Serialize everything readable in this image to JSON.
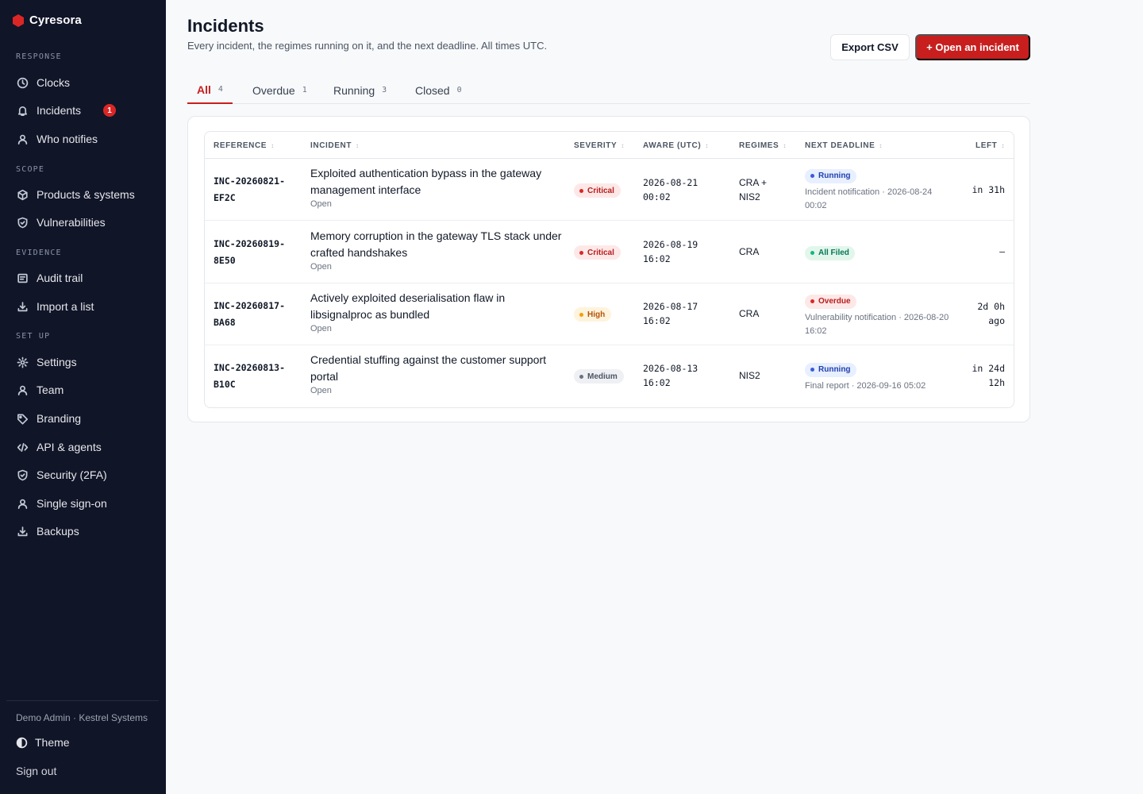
{
  "app": {
    "name": "Cyresora",
    "brand_color": "#dc2626"
  },
  "sidebar": {
    "sections": [
      {
        "label": "RESPONSE"
      },
      {
        "label": "SCOPE"
      },
      {
        "label": "EVIDENCE"
      },
      {
        "label": "SET UP"
      }
    ],
    "items": [
      {
        "label": "Clocks",
        "icon": "clock-icon"
      },
      {
        "label": "Incidents",
        "icon": "bell-icon",
        "badge": "1"
      },
      {
        "label": "Who notifies",
        "icon": "user-icon"
      },
      {
        "label": "Products & systems",
        "icon": "box-icon"
      },
      {
        "label": "Vulnerabilities",
        "icon": "shield-icon"
      },
      {
        "label": "Audit trail",
        "icon": "list-icon"
      },
      {
        "label": "Import a list",
        "icon": "download-icon"
      },
      {
        "label": "Settings",
        "icon": "gear-icon"
      },
      {
        "label": "Team",
        "icon": "user-icon"
      },
      {
        "label": "Branding",
        "icon": "tag-icon"
      },
      {
        "label": "API & agents",
        "icon": "code-icon"
      },
      {
        "label": "Security (2FA)",
        "icon": "shield-icon"
      },
      {
        "label": "Single sign-on",
        "icon": "user-icon"
      },
      {
        "label": "Backups",
        "icon": "download-icon"
      }
    ],
    "user": "Demo Admin · Kestrel Systems",
    "theme_label": "Theme",
    "signout_label": "Sign out"
  },
  "header": {
    "title": "Incidents",
    "subtitle": "Every incident, the regimes running on it, and the next deadline. All times UTC.",
    "export_label": "Export CSV",
    "open_label": "+ Open an incident"
  },
  "tabs": [
    {
      "label": "All",
      "count": "4",
      "active": true
    },
    {
      "label": "Overdue",
      "count": "1"
    },
    {
      "label": "Running",
      "count": "3"
    },
    {
      "label": "Closed",
      "count": "0"
    }
  ],
  "table": {
    "columns": [
      "REFERENCE",
      "INCIDENT",
      "SEVERITY",
      "AWARE (UTC)",
      "REGIMES",
      "NEXT DEADLINE",
      "LEFT"
    ],
    "sort_glyph": "↕",
    "rows": [
      {
        "ref_a": "INC-20260821-",
        "ref_b": "EF2C",
        "title": "Exploited authentication bypass in the gateway management interface",
        "status": "Open",
        "severity": "Critical",
        "aware_a": "2026-08-21",
        "aware_b": "00:02",
        "regimes": "CRA + NIS2",
        "pill": "Running",
        "deadline": "Incident notification · 2026-08-24 00:02",
        "left_a": "in 31h",
        "left_b": ""
      },
      {
        "ref_a": "INC-20260819-",
        "ref_b": "8E50",
        "title": "Memory corruption in the gateway TLS stack under crafted handshakes",
        "status": "Open",
        "severity": "Critical",
        "aware_a": "2026-08-19",
        "aware_b": "16:02",
        "regimes": "CRA",
        "pill": "All Filed",
        "deadline": "",
        "left_a": "—",
        "left_b": ""
      },
      {
        "ref_a": "INC-20260817-",
        "ref_b": "BA68",
        "title": "Actively exploited deserialisation flaw in libsignalproc as bundled",
        "status": "Open",
        "severity": "High",
        "aware_a": "2026-08-17",
        "aware_b": "16:02",
        "regimes": "CRA",
        "pill": "Overdue",
        "deadline": "Vulnerability notification · 2026-08-20 16:02",
        "left_a": "2d 0h",
        "left_b": "ago"
      },
      {
        "ref_a": "INC-20260813-",
        "ref_b": "B10C",
        "title": "Credential stuffing against the customer support portal",
        "status": "Open",
        "severity": "Medium",
        "aware_a": "2026-08-13",
        "aware_b": "16:02",
        "regimes": "NIS2",
        "pill": "Running",
        "deadline": "Final report · 2026-09-16 05:02",
        "left_a": "in 24d",
        "left_b": "12h"
      }
    ]
  },
  "colors": {
    "sidebar_bg": "#111528",
    "accent": "#c81e1e",
    "critical_bg": "#fde8e8",
    "critical_fg": "#b91c1c",
    "high_bg": "#fef3dc",
    "high_fg": "#b45309",
    "medium_bg": "#eef0f4",
    "medium_fg": "#4b5563",
    "running_bg": "#e8efff",
    "running_fg": "#1e40af",
    "filed_bg": "#e3f6ec",
    "filed_fg": "#047857",
    "overdue_bg": "#fde8e8",
    "overdue_fg": "#b91c1c"
  }
}
